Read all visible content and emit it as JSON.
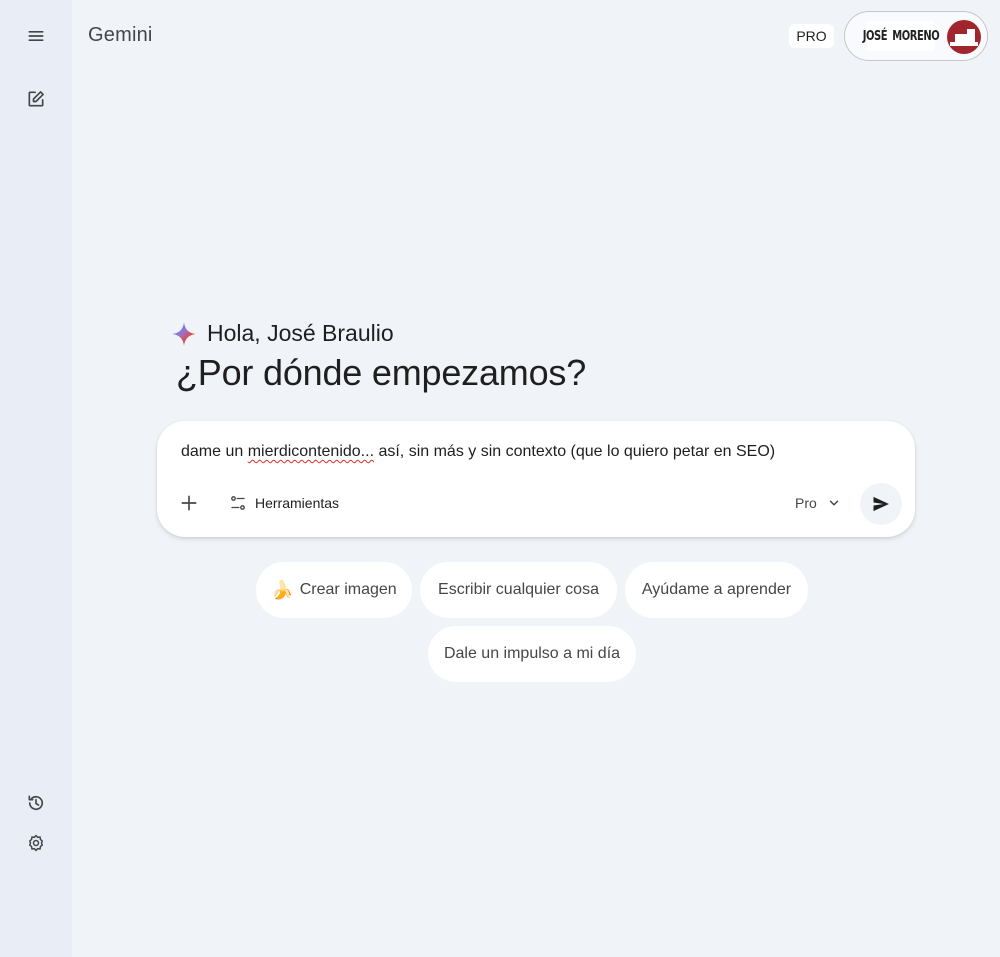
{
  "app": {
    "title": "Gemini",
    "plan_badge": "PRO"
  },
  "account": {
    "logo_left": "JOSÉ",
    "logo_right": "MORENO"
  },
  "rail": {
    "menu_icon": "menu-icon",
    "new_chat_icon": "edit-square-icon",
    "history_icon": "history-icon",
    "settings_icon": "gear-icon"
  },
  "greeting": {
    "hello": "Hola, José Braulio",
    "headline": "¿Por dónde empezamos?"
  },
  "prompt": {
    "text_before": "dame un ",
    "text_misspelled": "mierdicontenido...",
    "text_after": " así, sin más y sin contexto (que lo quiero petar en SEO)",
    "tools_label": "Herramientas",
    "model_label": "Pro"
  },
  "chips": [
    {
      "label": "Crear imagen",
      "emoji": "🍌"
    },
    {
      "label": "Escribir cualquier cosa"
    },
    {
      "label": "Ayúdame a aprender"
    },
    {
      "label": "Dale un impulso a mi día"
    }
  ],
  "colors": {
    "background": "#f0f4f9",
    "rail": "#e9eef6",
    "card": "#ffffff",
    "text": "#1f1f1f",
    "muted": "#444746",
    "avatar": "#a0252d",
    "spell_error": "#d93025"
  }
}
